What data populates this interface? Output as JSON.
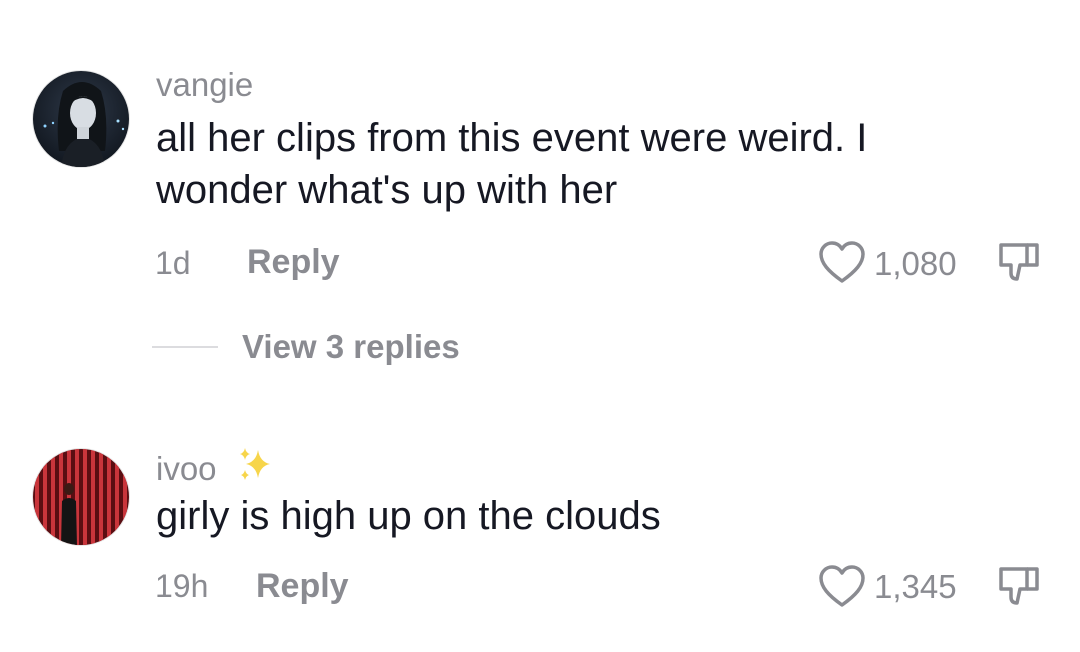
{
  "comments": [
    {
      "username": "vangie",
      "text_lines": [
        "all her clips from this event were weird. I",
        "wonder what's up with her"
      ],
      "time": "1d",
      "reply_label": "Reply",
      "like_count": "1,080",
      "like_icon": "heart-outline-icon",
      "dislike_icon": "thumbs-down-icon",
      "avatar": "avatar-anime-woman"
    },
    {
      "username": "ivoo",
      "username_decoration": "sparkles-emoji",
      "text_lines": [
        "girly is high up on the clouds"
      ],
      "time": "19h",
      "reply_label": "Reply",
      "like_count": "1,345",
      "like_icon": "heart-outline-icon",
      "dislike_icon": "thumbs-down-icon",
      "avatar": "avatar-red-striped"
    }
  ],
  "view_replies_label": "View 3 replies",
  "colors": {
    "primary_text": "#161823",
    "secondary_text": "#8a8b91",
    "background": "#ffffff"
  }
}
